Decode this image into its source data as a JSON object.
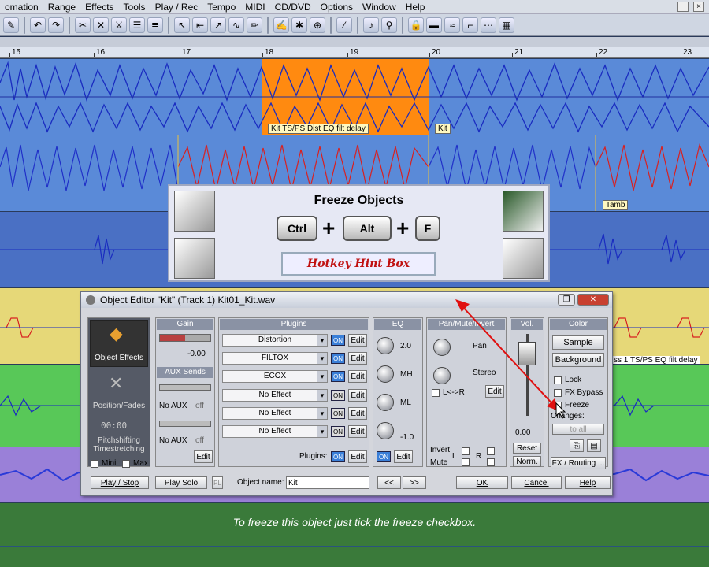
{
  "menu": [
    "omation",
    "Range",
    "Effects",
    "Tools",
    "Play / Rec",
    "Tempo",
    "MIDI",
    "CD/DVD",
    "Options",
    "Window",
    "Help"
  ],
  "ruler": [
    "15",
    "16",
    "17",
    "18",
    "19",
    "20",
    "21",
    "22",
    "23"
  ],
  "clips": {
    "selected_label": "Kit  TS/PS Dist EQ filt delay",
    "kit_label": "Kit",
    "tamb_label": "Tamb",
    "right_label": "ss 1  TS/PS EQ filt delay"
  },
  "hint": {
    "title": "Freeze Objects",
    "keys": [
      "Ctrl",
      "Alt",
      "F"
    ],
    "box": "Hotkey Hint Box"
  },
  "dialog": {
    "title": "Object Editor \"Kit\"  (Track 1)  Kit01_Kit.wav",
    "left": {
      "object_effects": "Object Effects",
      "position_fades": "Position/Fades",
      "pitch": "Pitchshifting\nTimestretching",
      "pitch_readout": "00:00",
      "mini": "Mini",
      "max": "Max"
    },
    "gain": {
      "head": "Gain",
      "value": "-0.00",
      "aux_head": "AUX Sends",
      "no_aux": "No AUX",
      "off": "off",
      "edit": "Edit"
    },
    "plugins": {
      "head": "Plugins",
      "items": [
        "Distortion",
        "FILTOX",
        "ECOX",
        "No Effect",
        "No Effect",
        "No Effect"
      ],
      "on": "ON",
      "edit": "Edit",
      "footer": "Plugins:"
    },
    "eq": {
      "head": "EQ",
      "labels": [
        "2.0",
        "MH",
        "ML",
        "-1.0"
      ],
      "on": "ON",
      "edit": "Edit"
    },
    "pan": {
      "head": "Pan/Mute/Invert",
      "pan": "Pan",
      "stereo": "Stereo",
      "lr": "L<->R",
      "edit": "Edit",
      "invert": "Invert",
      "mute": "Mute",
      "l": "L",
      "r": "R"
    },
    "vol": {
      "head": "Vol.",
      "value": "0.00",
      "reset": "Reset",
      "norm": "Norm."
    },
    "color": {
      "head": "Color",
      "sample": "Sample",
      "background": "Background",
      "lock": "Lock",
      "fx_bypass": "FX Bypass",
      "freeze": "Freeze",
      "changes": "Changes:",
      "to_all": "to all",
      "fx_routing": "FX / Routing ..."
    },
    "bottom": {
      "play_stop": "Play / Stop",
      "play_solo": "Play Solo",
      "pl": "PL",
      "object_name_label": "Object name:",
      "object_name": "Kit",
      "prev": "<<",
      "next": ">>",
      "ok": "OK",
      "cancel": "Cancel",
      "help": "Help"
    }
  },
  "subtitle": "To freeze this object just tick  the freeze checkbox."
}
